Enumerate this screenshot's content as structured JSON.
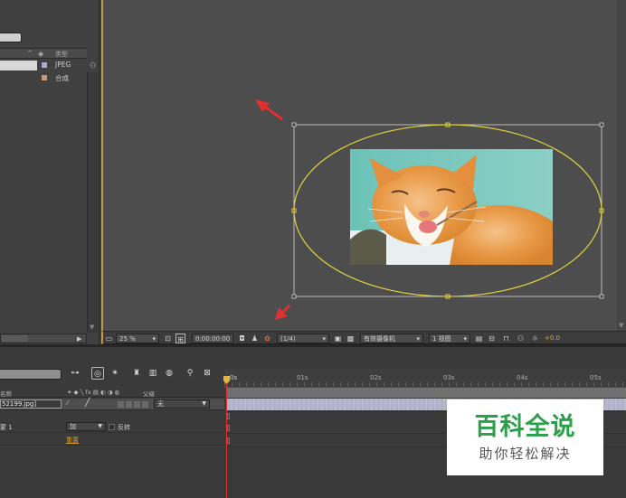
{
  "colors": {
    "accent_orange": "#c79c3c",
    "mask_yellow": "#e0d23c",
    "arrow_red": "#e03030",
    "playhead_red": "#d33333",
    "watermark_green": "#2aa04a",
    "reset_link": "#d89a2c"
  },
  "project": {
    "column_type_header": "类型",
    "items": [
      {
        "type": "JPEG",
        "swatch": "#aaaacc"
      },
      {
        "type": "合成",
        "swatch": "#c89a78"
      }
    ]
  },
  "viewer_toolbar": {
    "zoom": "25 %",
    "timecode": "0:00:00:00",
    "resolution": "(1/4)",
    "camera": "有效摄像机",
    "views": "1 视图",
    "exposure": "+0.0"
  },
  "timeline": {
    "ruler_start": "0s",
    "ruler_ticks": [
      "01s",
      "02s",
      "03s",
      "04s",
      "05s"
    ],
    "col_name_header": "名称",
    "col_parent_header": "父级",
    "layer": {
      "name": "52199.jpg]",
      "parent": "无"
    },
    "mask": {
      "name": "蒙 1",
      "mode": "加",
      "invert_label": "反转",
      "reset_label": "重置"
    }
  },
  "icons": {
    "project_tag": "tag-icon",
    "project_flow": "flowchart-icon",
    "viewer": [
      "region-icon",
      "grid-icon",
      "camera-snapshot-icon",
      "show-snapshot-icon",
      "color-channel-icon",
      "transparency-grid-icon",
      "fast-preview-icon",
      "timeline-icon",
      "flowchart-icon",
      "exposure-icon"
    ],
    "timeline": [
      "composition-mini-flowchart-icon",
      "live-update-icon",
      "draft-3d-icon",
      "shy-icon",
      "frame-blending-icon",
      "motion-blur-icon",
      "graph-editor-icon"
    ]
  },
  "watermark": {
    "title": "百科全说",
    "subtitle": "助你轻松解决"
  }
}
